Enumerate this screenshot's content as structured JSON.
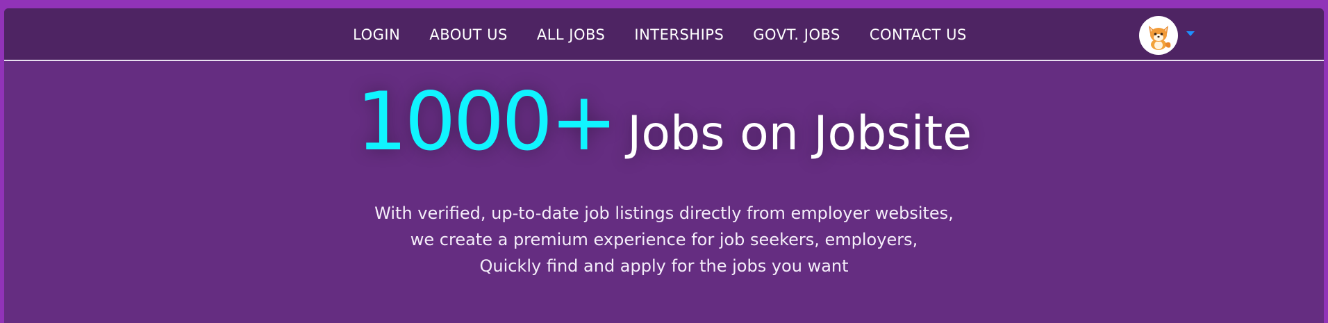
{
  "nav": {
    "items": [
      {
        "label": "LOGIN"
      },
      {
        "label": "ABOUT US"
      },
      {
        "label": "ALL JOBS"
      },
      {
        "label": "INTERSHIPS"
      },
      {
        "label": "GOVT. JOBS"
      },
      {
        "label": "CONTACT US"
      }
    ],
    "avatar_icon": "fox-avatar-icon",
    "dropdown_icon": "caret-down-icon"
  },
  "hero": {
    "count": "1000+",
    "title": "Jobs on Jobsite",
    "lines": [
      "With verified, up-to-date job listings directly from employer websites,",
      "we create a premium experience for job seekers, employers,",
      "Quickly find and apply for the jobs you want"
    ]
  },
  "colors": {
    "page_border": "#9133b8",
    "navbar": "#4e2463",
    "hero_bg": "#652d81",
    "accent": "#10f4ff",
    "caret": "#1e90ff"
  }
}
